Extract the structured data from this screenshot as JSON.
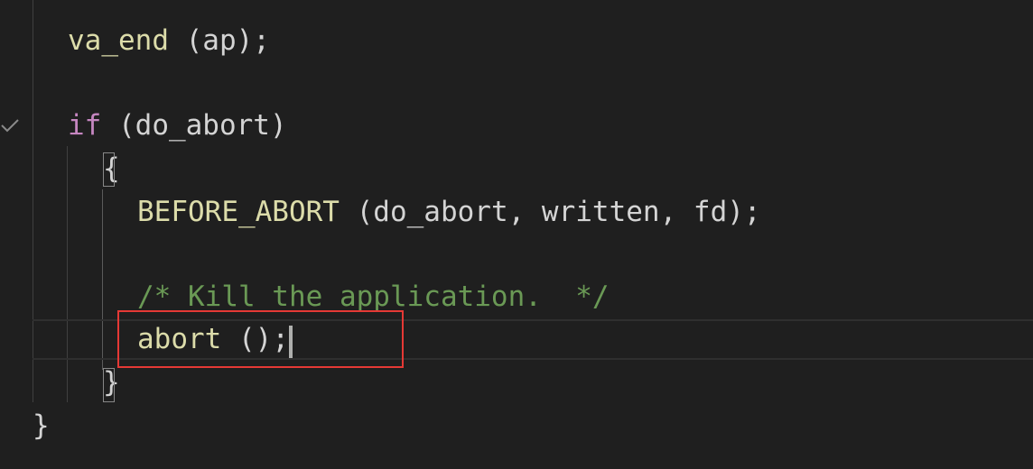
{
  "editor": {
    "lines": {
      "va_end": {
        "fn": "va_end",
        "args": " (ap);"
      },
      "if_stmt": {
        "kw": "if",
        "cond": " (do_abort)"
      },
      "open_brace": "{",
      "before_abort": {
        "fn": "BEFORE_ABORT",
        "args": " (do_abort, written, fd);"
      },
      "comment": "/* Kill the application.  */",
      "abort": {
        "fn": "abort",
        "args": " ();"
      },
      "inner_close_brace": "}",
      "outer_close_brace": "}"
    },
    "fold_icon": "checkmark-fold-icon",
    "colors": {
      "background": "#1f1f1f",
      "function": "#dcdcaa",
      "keyword": "#c586c0",
      "comment": "#6a9955",
      "highlight_box": "#e53935"
    }
  }
}
